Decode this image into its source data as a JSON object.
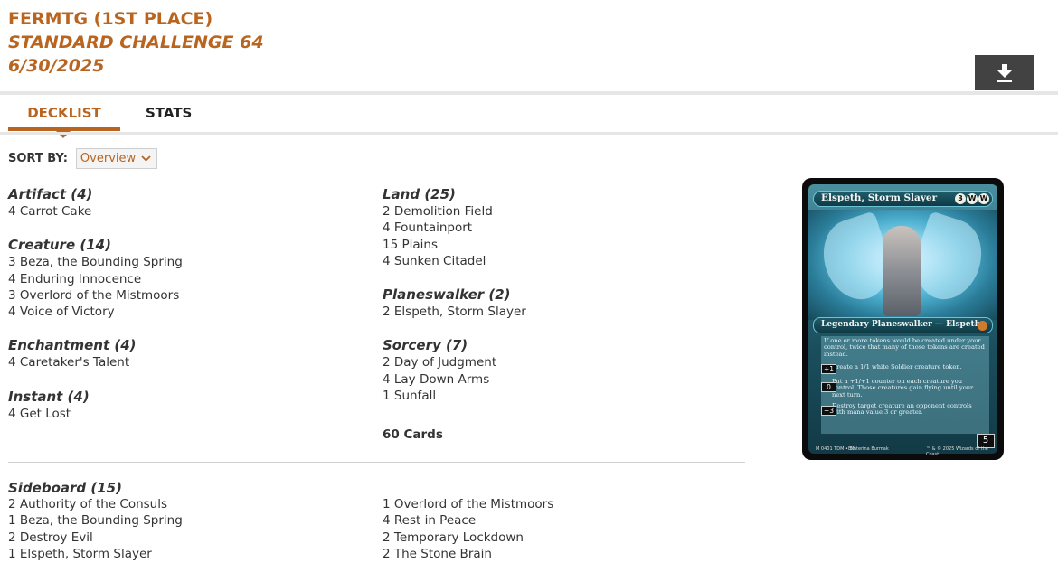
{
  "header": {
    "player": "FERMTG (1ST PLACE)",
    "event": "STANDARD CHALLENGE 64",
    "date": "6/30/2025"
  },
  "download_icon": "download-icon",
  "tabs": [
    {
      "label": "DECKLIST",
      "active": true
    },
    {
      "label": "STATS",
      "active": false
    }
  ],
  "sort": {
    "label": "SORT BY:",
    "selected": "Overview"
  },
  "colors": {
    "accent": "#b9651f",
    "button_bg": "#424242"
  },
  "deck": {
    "left": [
      {
        "title": "Artifact (4)",
        "cards": [
          "4 Carrot Cake"
        ]
      },
      {
        "title": "Creature (14)",
        "cards": [
          "3 Beza, the Bounding Spring",
          "4 Enduring Innocence",
          "3 Overlord of the Mistmoors",
          "4 Voice of Victory"
        ]
      },
      {
        "title": "Enchantment (4)",
        "cards": [
          "4 Caretaker's Talent"
        ]
      },
      {
        "title": "Instant (4)",
        "cards": [
          "4 Get Lost"
        ]
      }
    ],
    "right": [
      {
        "title": "Land (25)",
        "cards": [
          "2 Demolition Field",
          "4 Fountainport",
          "15 Plains",
          "4 Sunken Citadel"
        ]
      },
      {
        "title": "Planeswalker (2)",
        "cards": [
          "2 Elspeth, Storm Slayer"
        ]
      },
      {
        "title": "Sorcery (7)",
        "cards": [
          "2 Day of Judgment",
          "4 Lay Down Arms",
          "1 Sunfall"
        ]
      }
    ],
    "total": "60 Cards"
  },
  "sideboard": {
    "title": "Sideboard (15)",
    "left": [
      "2 Authority of the Consuls",
      "1 Beza, the Bounding Spring",
      "2 Destroy Evil",
      "1 Elspeth, Storm Slayer"
    ],
    "right": [
      "1 Overlord of the Mistmoors",
      "4 Rest in Peace",
      "2 Temporary Lockdown",
      "2 The Stone Brain"
    ]
  },
  "card": {
    "name": "Elspeth, Storm Slayer",
    "mana": [
      "3",
      "W",
      "W"
    ],
    "type_line": "Legendary Planeswalker — Elspeth",
    "static": "If one or more tokens would be created under your control, twice that many of those tokens are created instead.",
    "abilities": [
      {
        "cost": "+1",
        "text": "Create a 1/1 white Soldier creature token."
      },
      {
        "cost": "0",
        "text": "Put a +1/+1 counter on each creature you control. Those creatures gain flying until your next turn."
      },
      {
        "cost": "−3",
        "text": "Destroy target creature an opponent controls with mana value 3 or greater."
      }
    ],
    "loyalty": "5",
    "collector": "M 0401 TDM • EN",
    "artist": "Ekaterina Burmak",
    "copyright": "™ & © 2025 Wizards of the Coast"
  }
}
